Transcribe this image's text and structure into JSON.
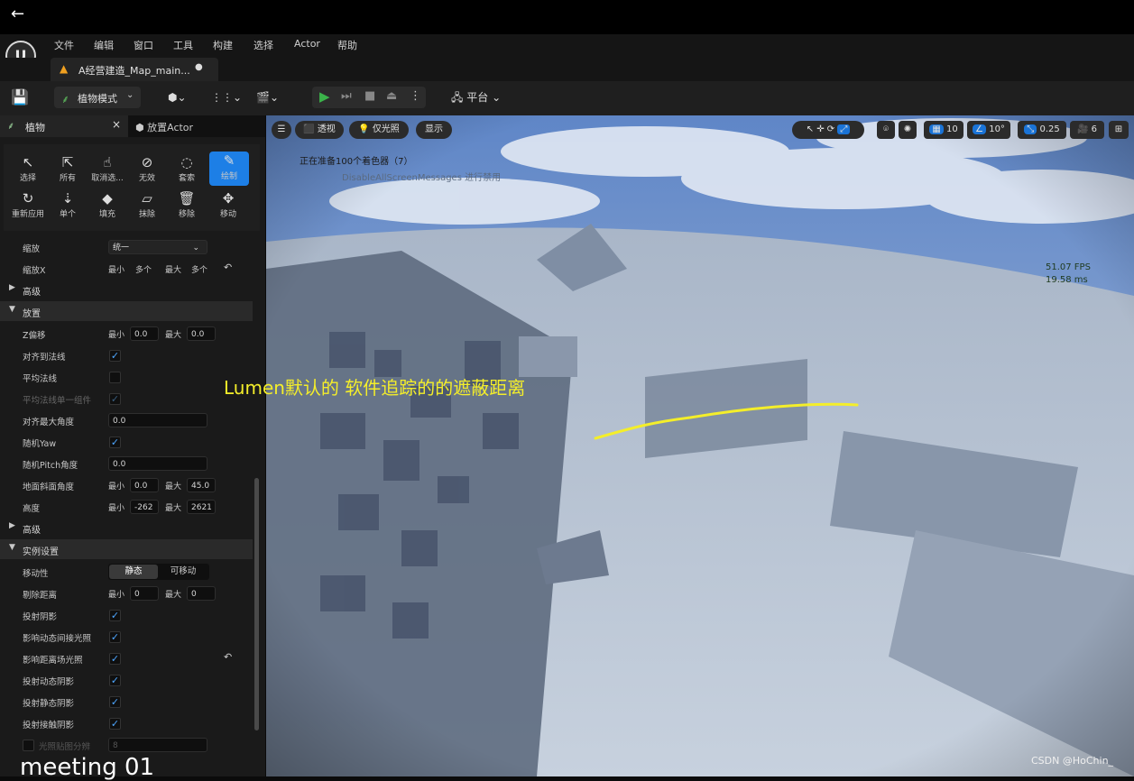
{
  "nav": {
    "back_icon": "arrow-left-icon"
  },
  "menu": {
    "items": [
      "文件",
      "编辑",
      "窗口",
      "工具",
      "构建",
      "选择",
      "Actor",
      "帮助"
    ]
  },
  "document_tab": {
    "label": "A经营建造_Map_main..."
  },
  "toolbar": {
    "mode_label": "植物模式",
    "platform_label": "平台"
  },
  "panel_tabs": {
    "foliage": "植物",
    "close": "×",
    "place_actor": "放置Actor"
  },
  "tools": [
    {
      "icon": "↖",
      "label": "选择"
    },
    {
      "icon": "⇱",
      "label": "所有"
    },
    {
      "icon": "☝",
      "label": "取消选..."
    },
    {
      "icon": "⊘",
      "label": "无效"
    },
    {
      "icon": "◌",
      "label": "套索"
    },
    {
      "icon": "✎",
      "label": "绘制"
    },
    {
      "icon": "↻",
      "label": "重新应用"
    },
    {
      "icon": "⇣",
      "label": "单个"
    },
    {
      "icon": "◆",
      "label": "填充"
    },
    {
      "icon": "▱",
      "label": "抹除"
    },
    {
      "icon": "🗑",
      "label": "移除"
    },
    {
      "icon": "✥",
      "label": "移动"
    }
  ],
  "scale": {
    "label": "缩放",
    "value": "统一",
    "x_label": "缩放X",
    "min": "最小",
    "min_value": "多个",
    "max": "最大",
    "max_value": "多个"
  },
  "sections": {
    "advanced": "高级",
    "placement": "放置",
    "advanced2": "高级",
    "instance": "实例设置"
  },
  "placement": {
    "z_offset": {
      "label": "Z偏移",
      "min": "0.0",
      "max": "0.0"
    },
    "align_normal": "对齐到法线",
    "average_normal": "平均法线",
    "average_normal_single": "平均法线单一组件",
    "align_max_angle": {
      "label": "对齐最大角度",
      "value": "0.0"
    },
    "random_yaw": "随机Yaw",
    "random_pitch": {
      "label": "随机Pitch角度",
      "value": "0.0"
    },
    "ground_slope": {
      "label": "地面斜面角度",
      "min": "0.0",
      "max": "45.0"
    },
    "height": {
      "label": "高度",
      "min": "-262",
      "max": "2621"
    }
  },
  "instance": {
    "mobility": {
      "label": "移动性",
      "static": "静态",
      "movable": "可移动"
    },
    "cull_distance": {
      "label": "剔除距离",
      "min": "0",
      "max": "0"
    },
    "cast_shadow": "投射阴影",
    "affect_dynamic_gi": "影响动态间接光照",
    "affect_distance_field": "影响距离场光照",
    "cast_dynamic_shadow": "投射动态阴影",
    "cast_static_shadow": "投射静态阴影",
    "cast_contact_shadow": "投射接触阴影",
    "lightmap_res": {
      "label": "光照贴图分辨",
      "value": "8"
    }
  },
  "viewport": {
    "perspective": "透视",
    "lit": "仅光照",
    "show": "显示",
    "grid_value": "10",
    "angle_value": "10°",
    "scale_value": "0.25",
    "camera_speed": "6",
    "message1": "正在准备100个着色器（7）",
    "message2": "DisableAllScreenMessages 进行禁用",
    "fps": "51.07 FPS",
    "ms": "19.58 ms",
    "annotation": "Lumen默认的 软件追踪的的遮蔽距离"
  },
  "overlay": {
    "meeting": "meeting 01",
    "watermark": "CSDN @HoChin_"
  },
  "colors": {
    "accent": "#1d7fe6",
    "annotation": "#f4ee2a",
    "play": "#3bb34a"
  }
}
